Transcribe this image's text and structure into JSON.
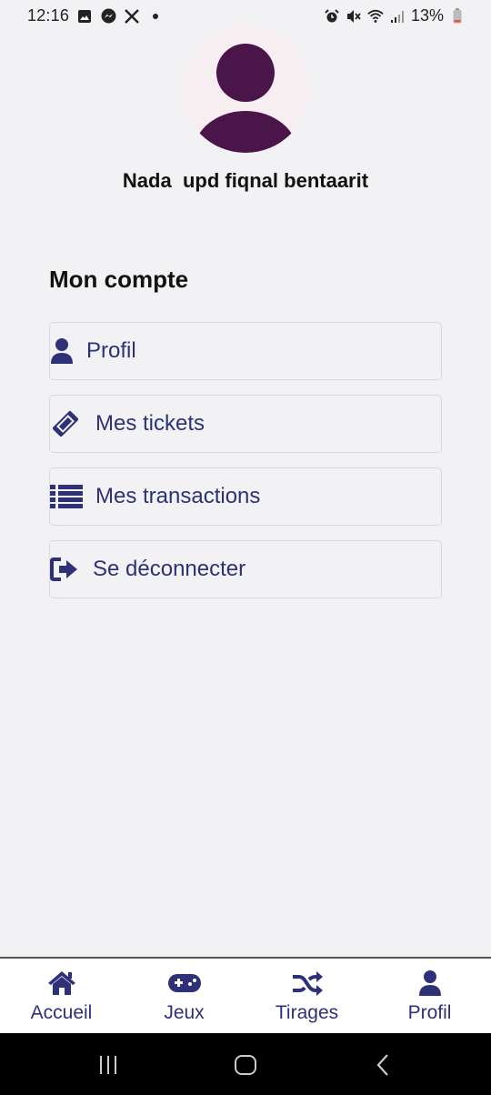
{
  "status_bar": {
    "time": "12:16",
    "left_icons": [
      "gallery-icon",
      "messenger-icon",
      "x-icon",
      "dot-icon"
    ],
    "right_icons": [
      "alarm-icon",
      "mute-icon",
      "wifi-icon",
      "signal-icon",
      "battery-icon"
    ],
    "battery": "13%"
  },
  "profile": {
    "name": "Nada  upd fiqnal bentaarit",
    "avatar_color": "#4a1548"
  },
  "section": {
    "title": "Mon compte"
  },
  "menu": {
    "items": [
      {
        "label": "Profil",
        "icon": "user-icon"
      },
      {
        "label": "Mes tickets",
        "icon": "ticket-icon"
      },
      {
        "label": "Mes transactions",
        "icon": "list-icon"
      },
      {
        "label": "Se déconnecter",
        "icon": "logout-icon"
      }
    ]
  },
  "bottom_nav": {
    "items": [
      {
        "label": "Accueil",
        "icon": "home-icon"
      },
      {
        "label": "Jeux",
        "icon": "gamepad-icon"
      },
      {
        "label": "Tirages",
        "icon": "shuffle-icon"
      },
      {
        "label": "Profil",
        "icon": "user-icon"
      }
    ]
  },
  "colors": {
    "accent": "#2e3177",
    "background": "#f2f2f4",
    "avatar": "#4a1548"
  }
}
